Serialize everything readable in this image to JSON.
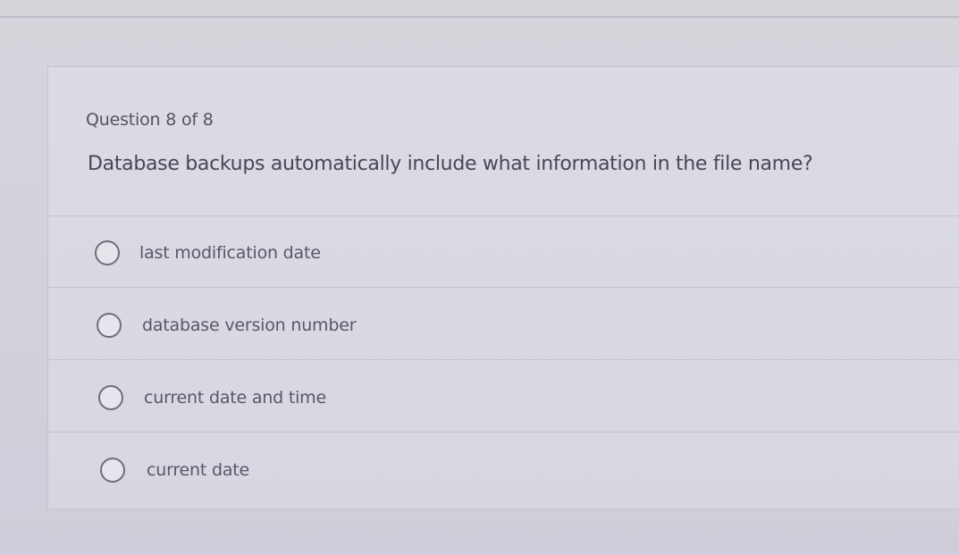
{
  "quiz": {
    "question_counter": "Question 8 of 8",
    "question_text": "Database backups automatically include what information in the file name?",
    "options": [
      {
        "label": "last modification date",
        "selected": false
      },
      {
        "label": "database version number",
        "selected": false
      },
      {
        "label": "current date and time",
        "selected": false
      },
      {
        "label": "current date",
        "selected": false
      }
    ]
  },
  "colors": {
    "background": "#d4d1dc",
    "card": "#dcdbe3",
    "text": "#48455a",
    "divider": "#c3c2cc"
  }
}
